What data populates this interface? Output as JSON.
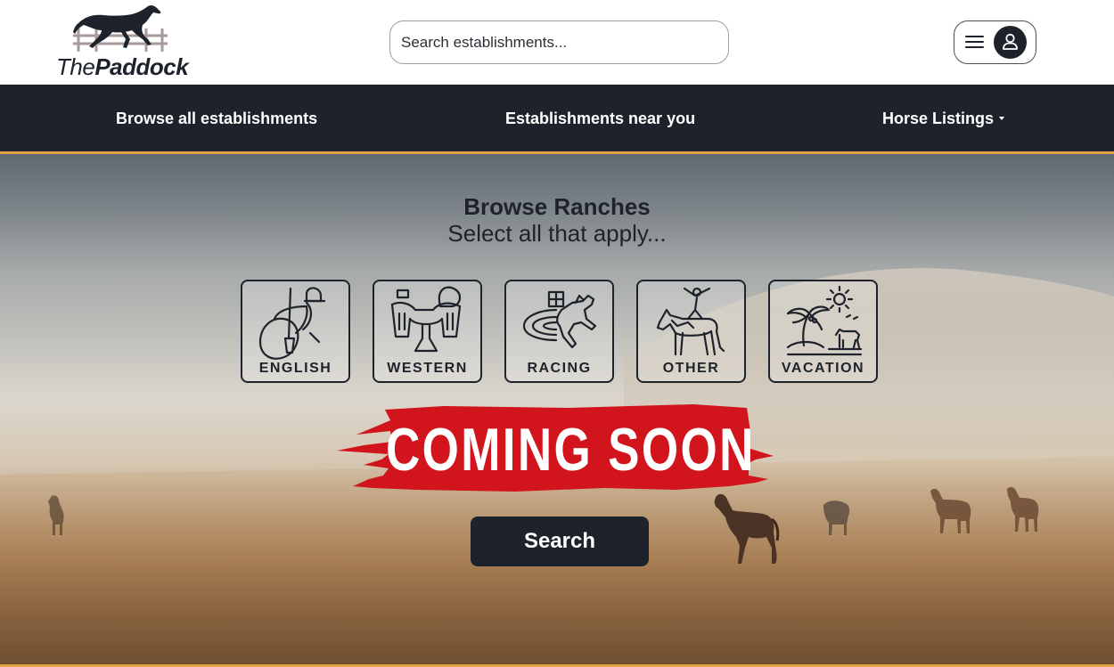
{
  "header": {
    "logo_text_part1": "The",
    "logo_text_part2": "Paddock",
    "search_placeholder": "Search establishments..."
  },
  "nav": {
    "items": [
      {
        "label": "Browse all establishments"
      },
      {
        "label": "Establishments near you"
      },
      {
        "label": "Horse Listings",
        "has_dropdown": true
      }
    ]
  },
  "hero": {
    "title": "Browse Ranches",
    "subtitle": "Select all that apply...",
    "categories": [
      {
        "label": "ENGLISH",
        "icon": "english-saddle-icon"
      },
      {
        "label": "WESTERN",
        "icon": "western-saddle-icon"
      },
      {
        "label": "RACING",
        "icon": "racing-horse-icon"
      },
      {
        "label": "OTHER",
        "icon": "vaulting-horse-icon"
      },
      {
        "label": "VACATION",
        "icon": "beach-horse-icon"
      }
    ],
    "banner": "COMING SOON",
    "search_button": "Search"
  },
  "colors": {
    "dark": "#1e232b",
    "accent": "#e4a24a",
    "banner_red": "#d2141c"
  }
}
